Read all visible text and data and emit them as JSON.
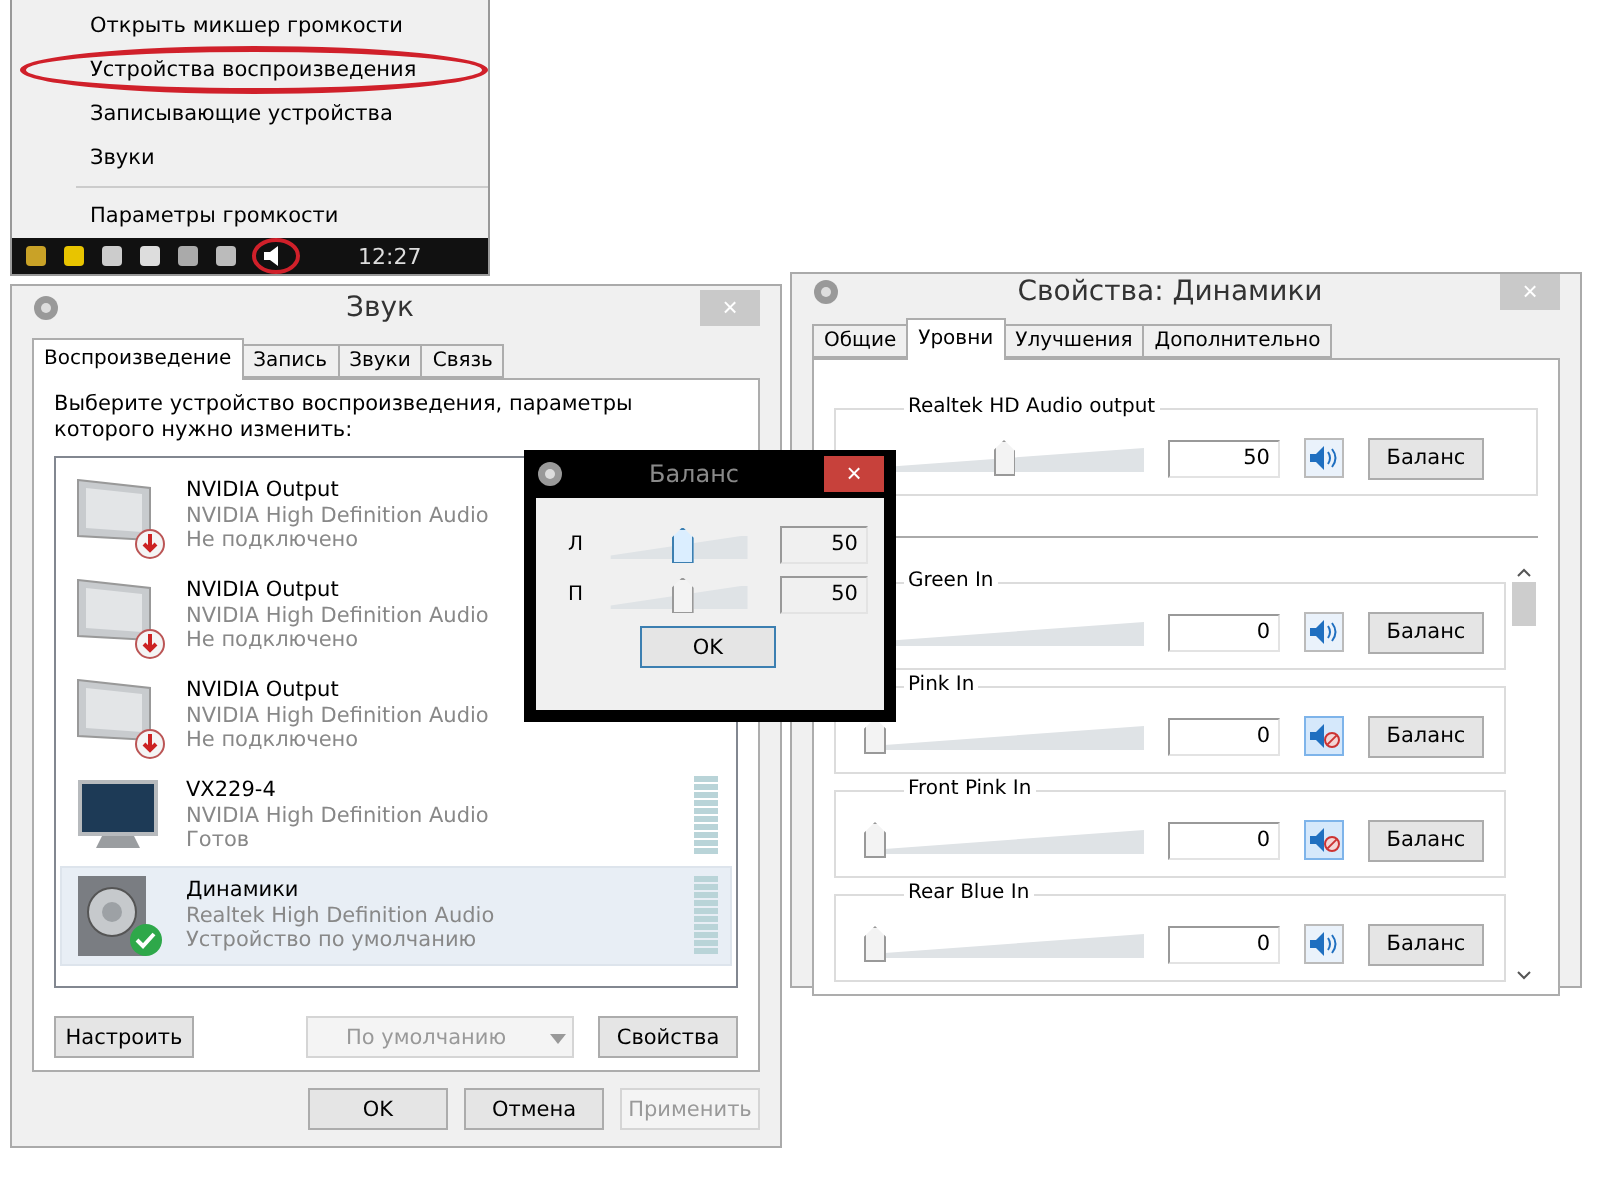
{
  "tray_menu": {
    "items": [
      {
        "label": "Открыть микшер громкости",
        "circled": false
      },
      {
        "label": "Устройства воспроизведения",
        "circled": true
      },
      {
        "label": "Записывающие устройства",
        "circled": false
      },
      {
        "label": "Звуки",
        "circled": false
      },
      {
        "label": "Параметры громкости",
        "circled": false
      }
    ],
    "clock": "12:27"
  },
  "sound_window": {
    "title": "Звук",
    "close": "×",
    "tabs": [
      {
        "label": "Воспроизведение",
        "selected": true
      },
      {
        "label": "Запись",
        "selected": false
      },
      {
        "label": "Звуки",
        "selected": false
      },
      {
        "label": "Связь",
        "selected": false
      }
    ],
    "prompt": "Выберите устройство воспроизведения, параметры которого нужно изменить:",
    "devices": [
      {
        "kind": "disconnected",
        "name": "NVIDIA Output",
        "driver": "NVIDIA High Definition Audio",
        "status": "Не подключено",
        "selected": false
      },
      {
        "kind": "disconnected",
        "name": "NVIDIA Output",
        "driver": "NVIDIA High Definition Audio",
        "status": "Не подключено",
        "selected": false
      },
      {
        "kind": "disconnected",
        "name": "NVIDIA Output",
        "driver": "NVIDIA High Definition Audio",
        "status": "Не подключено",
        "selected": false
      },
      {
        "kind": "monitor",
        "name": "VX229-4",
        "driver": "NVIDIA High Definition Audio",
        "status": "Готов",
        "selected": false
      },
      {
        "kind": "speaker",
        "name": "Динамики",
        "driver": "Realtek High Definition Audio",
        "status": "Устройство по умолчанию",
        "selected": true
      }
    ],
    "configure": "Настроить",
    "default_dropdown": {
      "value": "По умолчанию",
      "disabled": true
    },
    "properties": "Свойства",
    "footer_buttons": [
      {
        "label": "OK",
        "disabled": false
      },
      {
        "label": "Отмена",
        "disabled": false
      },
      {
        "label": "Применить",
        "disabled": true
      }
    ]
  },
  "properties_window": {
    "title": "Свойства: Динамики",
    "close": "×",
    "tabs": [
      {
        "label": "Общие",
        "selected": false
      },
      {
        "label": "Уровни",
        "selected": true
      },
      {
        "label": "Улучшения",
        "selected": false
      },
      {
        "label": "Дополнительно",
        "selected": false
      }
    ],
    "master": {
      "name": "Realtek HD Audio output",
      "level": 0.5,
      "value": "50",
      "muted": false,
      "balance": "Баланс"
    },
    "inputs": [
      {
        "name": "Green In",
        "value": "0",
        "muted": false,
        "balance": "Баланс"
      },
      {
        "name": "Pink In",
        "level": 0,
        "value": "0",
        "muted": true,
        "balance": "Баланс"
      },
      {
        "name": "Front Pink In",
        "level": 0,
        "value": "0",
        "muted": true,
        "balance": "Баланс"
      },
      {
        "name": "Rear Blue In",
        "level": 0,
        "value": "0",
        "muted": false,
        "balance": "Баланс"
      }
    ]
  },
  "balance_dialog": {
    "title": "Баланс",
    "close": "×",
    "channels": [
      {
        "label": "Л",
        "level": 0.5,
        "value": "50"
      },
      {
        "label": "П",
        "level": 0.5,
        "value": "50"
      }
    ],
    "ok": "OK"
  }
}
